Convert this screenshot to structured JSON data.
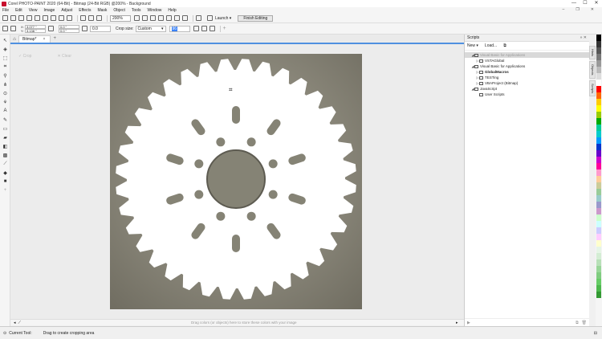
{
  "window": {
    "title": "Corel PHOTO-PAINT 2020 (64-Bit) - Bitmap (24-Bit RGB) @200% - Background",
    "controls": [
      "—",
      "☐",
      "✕"
    ]
  },
  "menu": [
    "File",
    "Edit",
    "View",
    "Image",
    "Adjust",
    "Effects",
    "Mask",
    "Object",
    "Tools",
    "Window",
    "Help"
  ],
  "toolbar": {
    "zoom": "200%",
    "launch_label": "Launch",
    "finish_label": "Finish Editing"
  },
  "propertybar": {
    "x_label": "X:",
    "x_value": "3.077 \"",
    "y_label": "Y:",
    "y_value": "3.138 \"",
    "w_value": "0.0 \"",
    "h_value": "0.0 \"",
    "rotation": "0.0",
    "crop_size_label": "Crop size:",
    "crop_size_value": "Custom",
    "resolution_value": "96"
  },
  "document": {
    "tab_label": "Bitmap*",
    "crop_apply": "Crop",
    "crop_clear": "Clear",
    "hint": "Drag colors (or objects) here to store these colors with your image"
  },
  "scripts_panel": {
    "title": "Scripts",
    "new_label": "New",
    "load_label": "Load...",
    "tree": [
      {
        "label": "Visual Basic for Applications",
        "level": 0,
        "selected": true,
        "expander": "◢",
        "bold": false
      },
      {
        "label": "VSTAGlobal",
        "level": 1,
        "selected": false,
        "expander": "▷",
        "bold": false
      },
      {
        "label": "Visual Basic for Applications",
        "level": 0,
        "selected": false,
        "expander": "◢",
        "bold": false
      },
      {
        "label": "GlobalMacros",
        "level": 1,
        "selected": false,
        "expander": "▷",
        "bold": true
      },
      {
        "label": "TESTing",
        "level": 1,
        "selected": false,
        "expander": "▷",
        "bold": false
      },
      {
        "label": "VBAProject (Bitmap)",
        "level": 1,
        "selected": false,
        "expander": "▷",
        "bold": false
      },
      {
        "label": "JavaScript",
        "level": 0,
        "selected": false,
        "expander": "◢",
        "bold": false
      },
      {
        "label": "User Scripts",
        "level": 1,
        "selected": false,
        "expander": "",
        "bold": false
      }
    ]
  },
  "side_tabs": [
    "Hints",
    "Objects",
    "Scripts"
  ],
  "palette_colors": [
    "#000000",
    "#333333",
    "#555555",
    "#777777",
    "#999999",
    "#bbbbbb",
    "#dddddd",
    "#ffffff",
    "#ff0000",
    "#ff6600",
    "#ffcc00",
    "#ffff00",
    "#99cc00",
    "#00aa00",
    "#00cc99",
    "#00cccc",
    "#0099ff",
    "#0033cc",
    "#6600cc",
    "#cc00cc",
    "#ff0099",
    "#ff99cc",
    "#ffcc99",
    "#cccc99",
    "#99cc99",
    "#99cccc",
    "#9999cc",
    "#cc99cc",
    "#ccffcc",
    "#ccffff",
    "#ccccff",
    "#ffccff",
    "#ffffcc",
    "#e6f5e6",
    "#d4edd4",
    "#b8e0b8",
    "#99d699",
    "#80cc80",
    "#66cc66",
    "#4db84d",
    "#339933"
  ],
  "status": {
    "tool_label": "Current Tool:",
    "message": "Drag to create cropping area"
  }
}
